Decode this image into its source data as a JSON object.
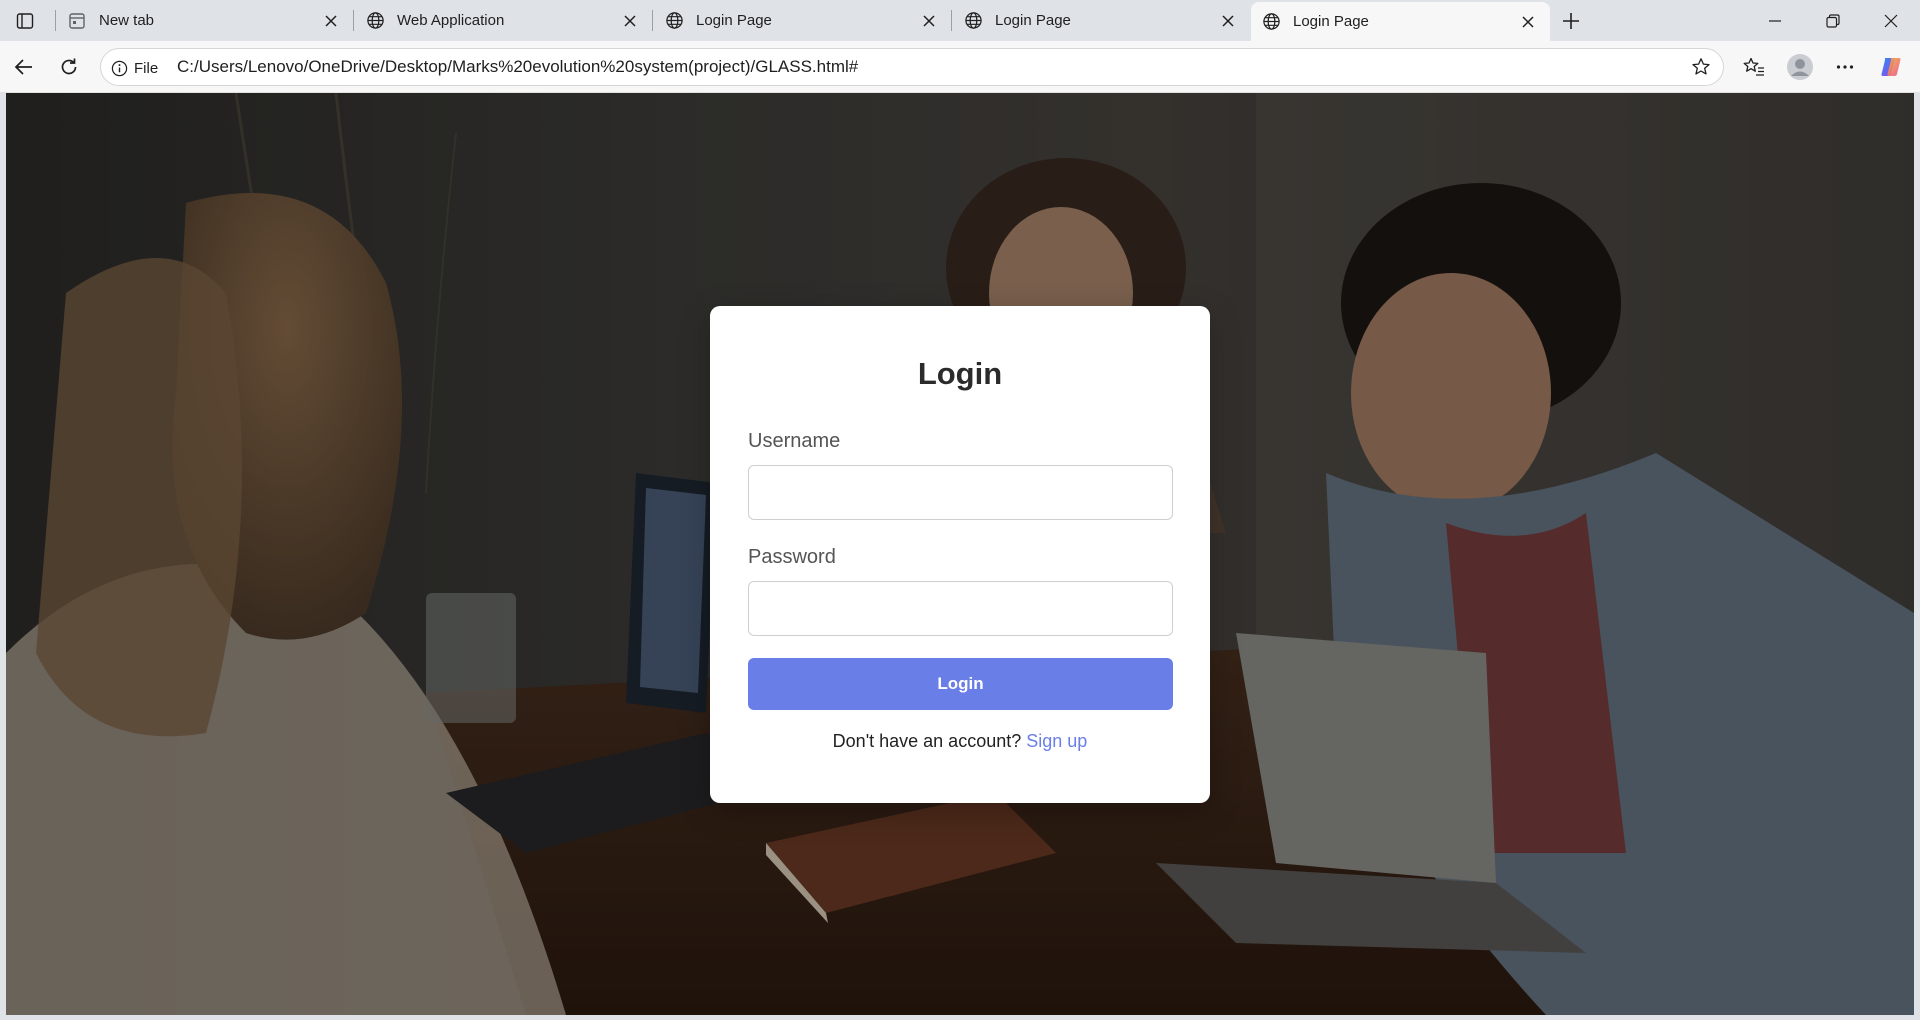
{
  "browser": {
    "tabs": [
      {
        "title": "New tab",
        "icon": "newtab-page-icon",
        "active": false
      },
      {
        "title": "Web Application",
        "icon": "globe-icon",
        "active": false
      },
      {
        "title": "Login Page",
        "icon": "globe-icon",
        "active": false
      },
      {
        "title": "Login Page",
        "icon": "globe-icon",
        "active": false
      },
      {
        "title": "Login Page",
        "icon": "globe-icon",
        "active": true
      }
    ],
    "address": {
      "scheme_label": "File",
      "url": "C:/Users/Lenovo/OneDrive/Desktop/Marks%20evolution%20system(project)/GLASS.html#"
    }
  },
  "page": {
    "login": {
      "title": "Login",
      "username_label": "Username",
      "username_value": "",
      "password_label": "Password",
      "password_value": "",
      "button_label": "Login",
      "signup_prompt": "Don't have an account?",
      "signup_link": "Sign up"
    }
  },
  "colors": {
    "accent": "#6a7ee8",
    "card": "#ffffff",
    "chrome": "#dfe3e8",
    "toolbar": "#f7f7f7"
  }
}
